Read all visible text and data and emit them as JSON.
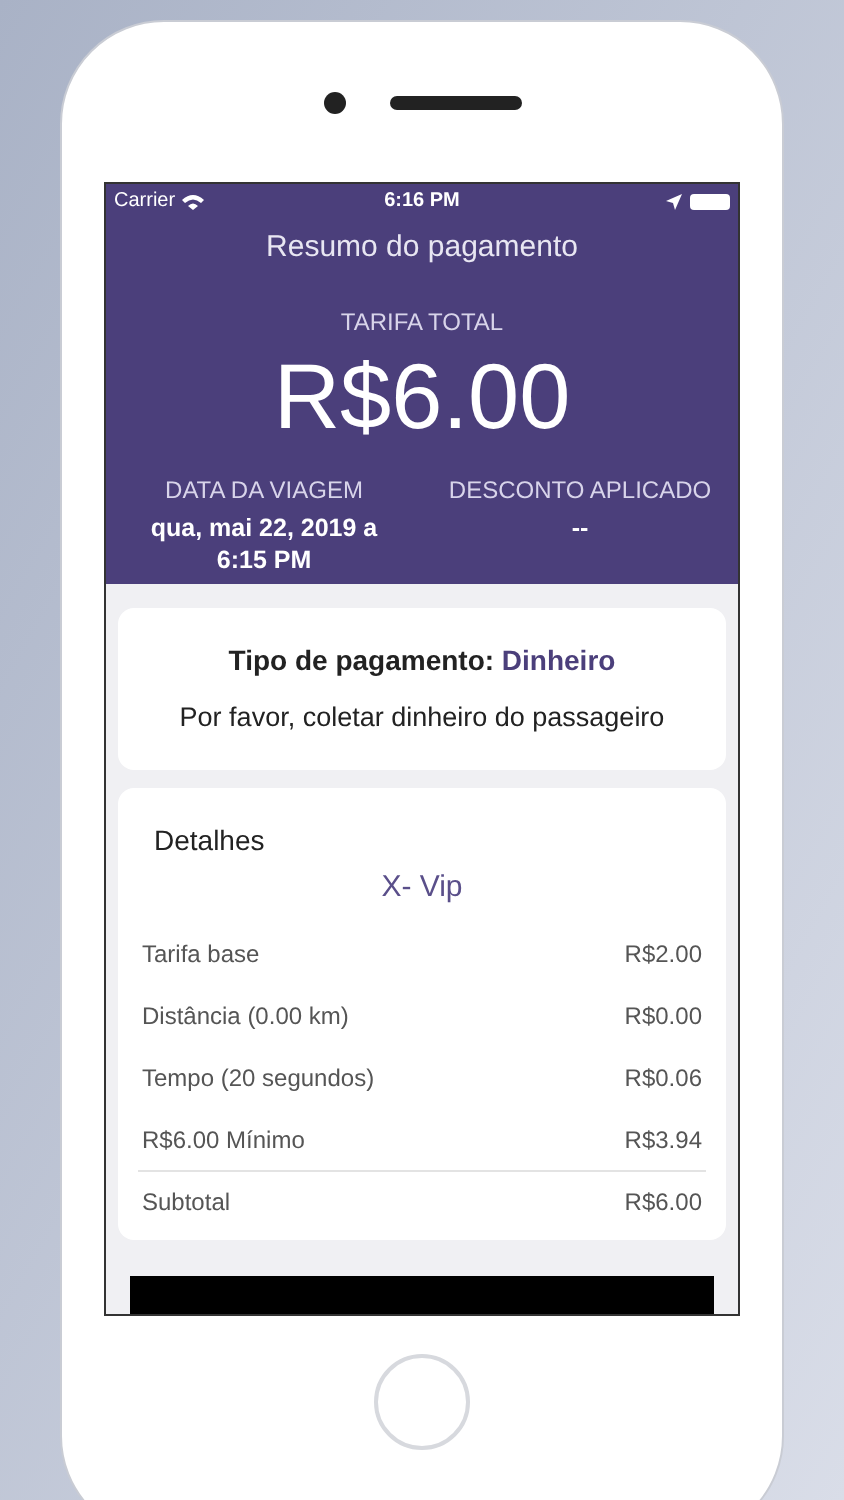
{
  "status_bar": {
    "carrier": "Carrier",
    "time": "6:16 PM"
  },
  "header": {
    "title": "Resumo do pagamento",
    "total_label": "TARIFA TOTAL",
    "total": "R$6.00",
    "columns": [
      {
        "label": "DATA DA VIAGEM",
        "value": "qua, mai 22, 2019 a 6:15 PM"
      },
      {
        "label": "DESCONTO APLICADO",
        "value": "--"
      }
    ]
  },
  "payment": {
    "text": "Tipo de pagamento: **Dinheiro**",
    "note": "Por favor, coletar dinheiro do passageiro"
  },
  "details": {
    "title": "Detalhes",
    "category": "X- Vip",
    "rows": [
      {
        "label": "Tarifa base",
        "value": "R$2.00"
      },
      {
        "label": "Distância (0.00 km)",
        "value": "R$0.00"
      },
      {
        "label": "Tempo (20 segundos)",
        "value": "R$0.06"
      },
      {
        "label": "R$6.00 Mínimo",
        "value": "R$3.94"
      },
      {
        "label": "Subtotal",
        "value": "R$6.00",
        "kind": "total"
      }
    ]
  }
}
